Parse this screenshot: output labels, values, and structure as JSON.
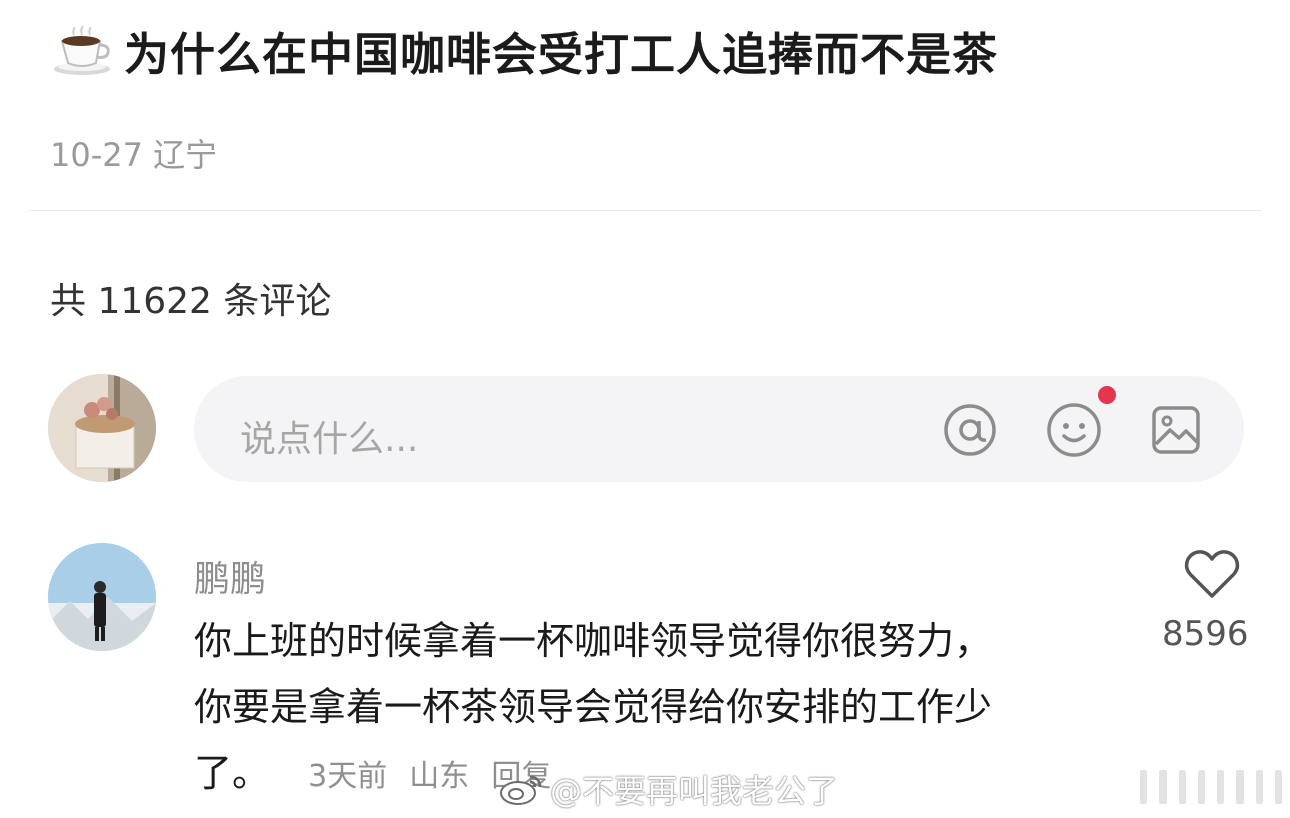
{
  "post": {
    "title": "为什么在中国咖啡会受打工人追捧而不是茶",
    "title_icon": "coffee-cup-icon",
    "meta": "10-27 辽宁"
  },
  "comments_header": {
    "count_text": "共 11622 条评论"
  },
  "comment_input": {
    "placeholder": "说点什么...",
    "icons": [
      "at-icon",
      "emoji-icon",
      "image-icon"
    ],
    "notification_dot_color": "#e5354f"
  },
  "comment": {
    "author": "鹏鹏",
    "lines": [
      "你上班的时候拿着一杯咖啡领导觉得你很努力，",
      "你要是拿着一杯茶领导会觉得给你安排的工作少",
      "了。"
    ],
    "time": "3天前",
    "location": "山东",
    "reply_label": "回复",
    "likes": "8596"
  },
  "watermark": {
    "text": "@不要再叫我老公了"
  }
}
